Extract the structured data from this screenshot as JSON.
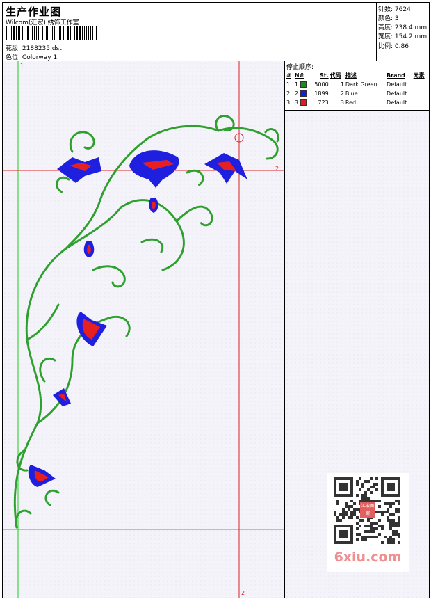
{
  "header": {
    "title": "生产作业图",
    "company": "Wilcom(汇宏) 绣饰工作室",
    "design_label": "花版:",
    "design_file": "2188235.dst",
    "colorway_label": "色位:",
    "colorway": "Colorway 1"
  },
  "specs": [
    {
      "label": "针数:",
      "value": "7624"
    },
    {
      "label": "颜色:",
      "value": "3"
    },
    {
      "label": "高度:",
      "value": "238.4 mm"
    },
    {
      "label": "宽度:",
      "value": "154.2 mm"
    },
    {
      "label": "比例:",
      "value": "0.86"
    }
  ],
  "guides": {
    "v1": "1",
    "v2": "2",
    "h2": "2",
    "b2": "2"
  },
  "stop_sequence": {
    "title": "停止顺序:",
    "columns": [
      "#",
      "N#",
      "St.",
      "代码",
      "描述",
      "Brand",
      "元素"
    ],
    "rows": [
      {
        "idx": "1.",
        "n": "1",
        "stitches": "5000",
        "code": "1",
        "desc": "Dark Green",
        "brand": "Default",
        "color": "#1a8a1a"
      },
      {
        "idx": "2.",
        "n": "2",
        "stitches": "1899",
        "code": "2",
        "desc": "Blue",
        "brand": "Default",
        "color": "#1a1ae6"
      },
      {
        "idx": "3.",
        "n": "3",
        "stitches": "723",
        "code": "3",
        "desc": "Red",
        "brand": "Default",
        "color": "#e61a1a"
      }
    ]
  },
  "watermark": {
    "site": "6xiu.com",
    "badge": "汇宏图案"
  },
  "colors": {
    "green": "#2ea02e",
    "blue": "#1f1fe0",
    "red": "#e62020",
    "guide_green": "#22cc22",
    "guide_red": "#dd2222"
  }
}
